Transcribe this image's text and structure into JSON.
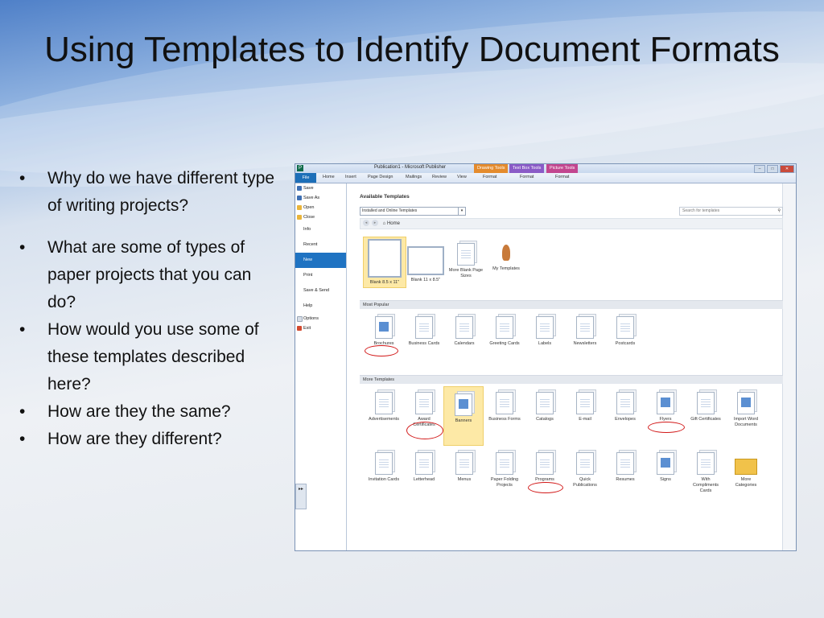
{
  "slide": {
    "title": "Using Templates to Identify Document Formats",
    "bullets": [
      "Why do we have different type of writing projects?",
      "What are some of types of paper projects that you can do?",
      "How would you use some of these templates described here?",
      "How are they the same?",
      "How are they different?"
    ]
  },
  "window": {
    "app_title": "Publication1 - Microsoft Publisher",
    "context_tabs": [
      "Drawing Tools",
      "Text Box Tools",
      "Picture Tools"
    ],
    "ribbon_tabs": [
      "File",
      "Home",
      "Insert",
      "Page Design",
      "Mailings",
      "Review",
      "View",
      "Format",
      "Format",
      "Format"
    ],
    "file_menu": {
      "commands": [
        "Save",
        "Save As",
        "Open",
        "Close"
      ],
      "categories": [
        "Info",
        "Recent",
        "New",
        "Print",
        "Save & Send",
        "Help"
      ],
      "selected": "New",
      "bottom": [
        "Options",
        "Exit"
      ]
    },
    "available_templates_label": "Available Templates",
    "dropdown_value": "Installed and Online Templates",
    "search_placeholder": "Search for templates",
    "home_label": "Home",
    "blank_tiles": [
      "Blank 8.5 x 11\"",
      "Blank 11 x 8.5\"",
      "More Blank Page Sizes",
      "My Templates"
    ],
    "most_popular_label": "Most Popular",
    "most_popular": [
      "Brochures",
      "Business Cards",
      "Calendars",
      "Greeting Cards",
      "Labels",
      "Newsletters",
      "Postcards"
    ],
    "more_templates_label": "More Templates",
    "more_templates_row1": [
      "Advertisements",
      "Award Certificates",
      "Banners",
      "Business Forms",
      "Catalogs",
      "E-mail",
      "Envelopes",
      "Flyers",
      "Gift Certificates",
      "Import Word Documents"
    ],
    "more_templates_row2": [
      "Invitation Cards",
      "Letterhead",
      "Menus",
      "Paper Folding Projects",
      "Programs",
      "Quick Publications",
      "Resumes",
      "Signs",
      "With Compliments Cards",
      "More Categories"
    ]
  },
  "colors": {
    "accent_blue": "#1f73c2",
    "highlight_tile": "#fde9a6",
    "annotation_circle": "#d21818"
  },
  "icons": {
    "search": "magnifier-icon",
    "home": "home-icon",
    "folder": "folder-icon",
    "publisher_logo": "publisher-logo-icon"
  }
}
